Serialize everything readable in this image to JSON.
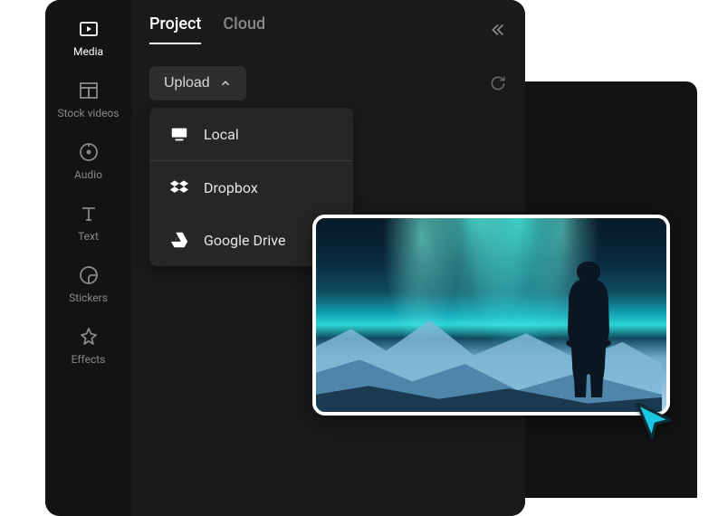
{
  "sidebar": {
    "items": [
      {
        "label": "Media"
      },
      {
        "label": "Stock videos"
      },
      {
        "label": "Audio"
      },
      {
        "label": "Text"
      },
      {
        "label": "Stickers"
      },
      {
        "label": "Effects"
      }
    ]
  },
  "tabs": {
    "project": "Project",
    "cloud": "Cloud"
  },
  "upload": {
    "button_label": "Upload",
    "options": {
      "local": "Local",
      "dropbox": "Dropbox",
      "google_drive": "Google Drive"
    }
  },
  "colors": {
    "cursor": "#1BC7E0"
  }
}
